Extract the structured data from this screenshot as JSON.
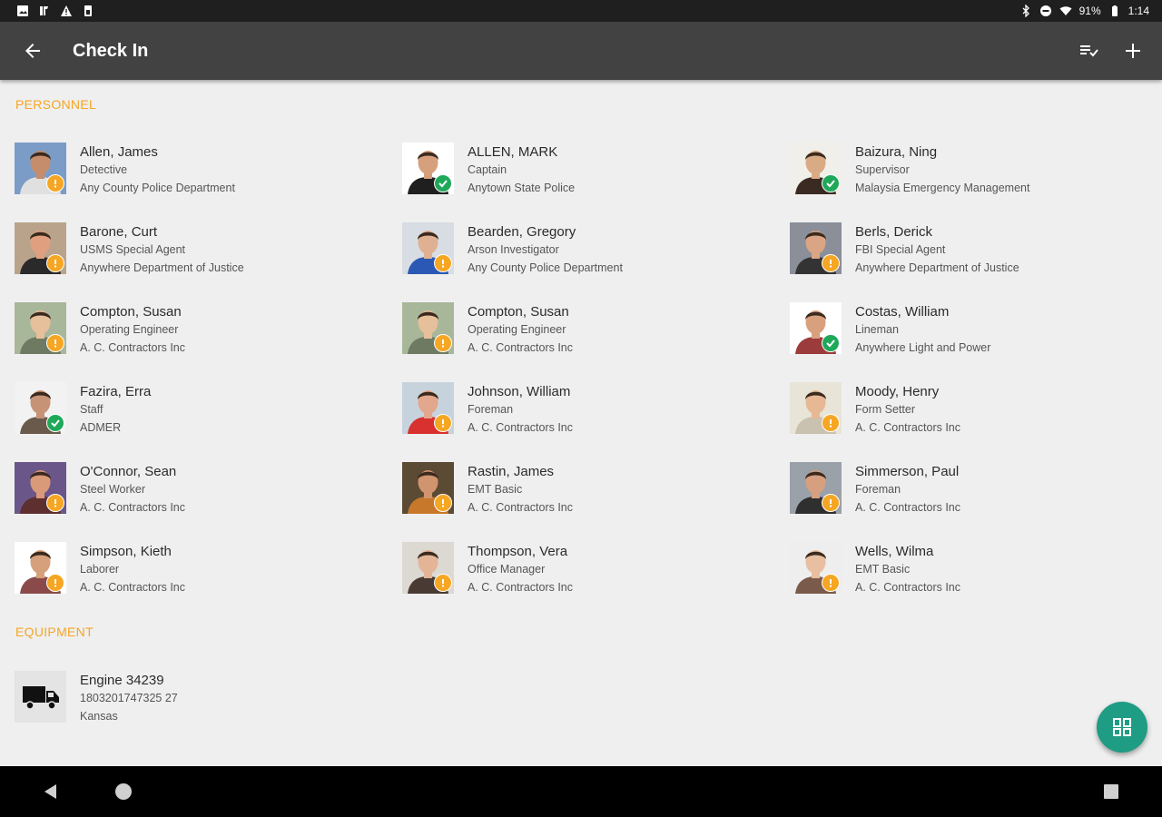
{
  "status_bar": {
    "battery": "91%",
    "time": "1:14"
  },
  "app_bar": {
    "title": "Check In"
  },
  "personnel": {
    "header": "PERSONNEL",
    "items": [
      {
        "name": "Allen, James",
        "title": "Detective",
        "org": "Any County Police Department",
        "status": "warning",
        "avatar_bg": "#7a9cc6",
        "skin": "#c58d6b",
        "shirt": "#e0e0e0"
      },
      {
        "name": "ALLEN, MARK",
        "title": "Captain",
        "org": "Anytown State Police",
        "status": "checked",
        "avatar_bg": "#ffffff",
        "skin": "#d7a07c",
        "shirt": "#1f1f1f"
      },
      {
        "name": "Baizura, Ning",
        "title": "Supervisor",
        "org": "Malaysia Emergency Management",
        "status": "checked",
        "avatar_bg": "#f1efe9",
        "skin": "#d9ab85",
        "shirt": "#3a2a22"
      },
      {
        "name": "Barone, Curt",
        "title": "USMS Special Agent",
        "org": "Anywhere Department of Justice",
        "status": "warning",
        "avatar_bg": "#b9a48b",
        "skin": "#e0a080",
        "shirt": "#2a2a2a"
      },
      {
        "name": "Bearden, Gregory",
        "title": "Arson Investigator",
        "org": "Any County Police Department",
        "status": "warning",
        "avatar_bg": "#d8dde3",
        "skin": "#e0b092",
        "shirt": "#2a58b4"
      },
      {
        "name": "Berls, Derick",
        "title": "FBI Special Agent",
        "org": "Anywhere Department of Justice",
        "status": "warning",
        "avatar_bg": "#8a8f9a",
        "skin": "#d9a584",
        "shirt": "#333333"
      },
      {
        "name": "Compton, Susan",
        "title": "Operating Engineer",
        "org": "A. C. Contractors Inc",
        "status": "warning",
        "avatar_bg": "#a8b79a",
        "skin": "#e6bf9b",
        "shirt": "#6f7a63"
      },
      {
        "name": "Compton, Susan",
        "title": "Operating Engineer",
        "org": "A. C. Contractors Inc",
        "status": "warning",
        "avatar_bg": "#a8b79a",
        "skin": "#e6bf9b",
        "shirt": "#6f7a63"
      },
      {
        "name": "Costas, William",
        "title": "Lineman",
        "org": "Anywhere Light and Power",
        "status": "checked",
        "avatar_bg": "#ffffff",
        "skin": "#d9a07e",
        "shirt": "#9c3b3b"
      },
      {
        "name": "Fazira, Erra",
        "title": "Staff",
        "org": "ADMER",
        "status": "checked",
        "avatar_bg": "#f2f2f2",
        "skin": "#c79377",
        "shirt": "#6a5a4c"
      },
      {
        "name": "Johnson, William",
        "title": "Foreman",
        "org": "A. C. Contractors Inc",
        "status": "warning",
        "avatar_bg": "#c7d3dc",
        "skin": "#e2a78c",
        "shirt": "#d93030"
      },
      {
        "name": "Moody, Henry",
        "title": "Form Setter",
        "org": "A. C. Contractors Inc",
        "status": "warning",
        "avatar_bg": "#e8e4d8",
        "skin": "#e6b894",
        "shirt": "#c9c2b0"
      },
      {
        "name": "O'Connor, Sean",
        "title": "Steel Worker",
        "org": "A. C. Contractors Inc",
        "status": "warning",
        "avatar_bg": "#6a5688",
        "skin": "#d99a7a",
        "shirt": "#5e2f2f"
      },
      {
        "name": "Rastin, James",
        "title": "EMT Basic",
        "org": "A. C. Contractors Inc",
        "status": "warning",
        "avatar_bg": "#5b4a34",
        "skin": "#d0946e",
        "shirt": "#c7782a"
      },
      {
        "name": "Simmerson, Paul",
        "title": "Foreman",
        "org": "A. C. Contractors Inc",
        "status": "warning",
        "avatar_bg": "#9aa1a8",
        "skin": "#d6a080",
        "shirt": "#2f2f2f"
      },
      {
        "name": "Simpson, Kieth",
        "title": "Laborer",
        "org": "A. C. Contractors Inc",
        "status": "warning",
        "avatar_bg": "#ffffff",
        "skin": "#d6a07c",
        "shirt": "#8a4a4a"
      },
      {
        "name": "Thompson, Vera",
        "title": "Office Manager",
        "org": "A. C. Contractors Inc",
        "status": "warning",
        "avatar_bg": "#dcd8d2",
        "skin": "#e4b497",
        "shirt": "#4a3a34"
      },
      {
        "name": "Wells, Wilma",
        "title": "EMT Basic",
        "org": "A. C. Contractors Inc",
        "status": "warning",
        "avatar_bg": "#eeeeee",
        "skin": "#e8bfa0",
        "shirt": "#7a5a4a"
      }
    ]
  },
  "equipment": {
    "header": "EQUIPMENT",
    "items": [
      {
        "name": "Engine 34239",
        "serial": "1803201747325 27",
        "location": "Kansas",
        "icon": "truck-icon"
      }
    ]
  },
  "colors": {
    "accent": "#f5a623",
    "app_bar": "#424242",
    "fab": "#1f9c84",
    "check": "#1fa85a"
  }
}
